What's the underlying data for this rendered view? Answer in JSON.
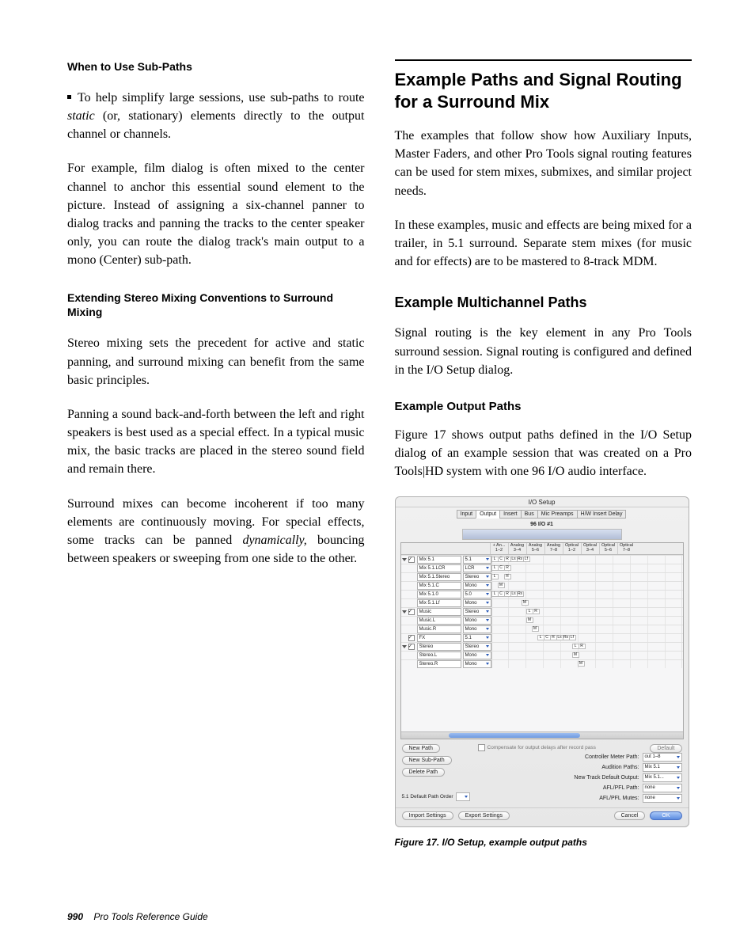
{
  "left": {
    "h1": "When to Use Sub-Paths",
    "bullet_pre": "To help simplify large sessions, use sub-paths to route ",
    "bullet_em": "static",
    "bullet_post": " (or, stationary) elements directly to the output channel or channels.",
    "p2": "For example, film dialog is often mixed to the center channel to anchor this essential sound element to the picture. Instead of assigning a six-channel panner to dialog tracks and panning the tracks to the center speaker only, you can route the dialog track's main output to a mono (Center) sub-path.",
    "h2": "Extending Stereo Mixing Conventions to Surround Mixing",
    "p3": "Stereo mixing sets the precedent for active and static panning, and surround mixing can benefit from the same basic principles.",
    "p4": "Panning a sound back-and-forth between the left and right speakers is best used as a special effect. In a typical music mix, the basic tracks are placed in the stereo sound field and remain there.",
    "p5a": "Surround mixes can become incoherent if too many elements are continuously moving. For special effects, some tracks can be panned ",
    "p5em": "dynamically,",
    "p5b": " bouncing between speakers or sweeping from one side to the other."
  },
  "right": {
    "h1": "Example Paths and Signal Routing for a Surround Mix",
    "p1": "The examples that follow show how Auxiliary Inputs, Master Faders, and other Pro Tools signal routing features can be used for stem mixes, submixes, and similar project needs.",
    "p2": "In these examples, music and effects are being mixed for a trailer, in 5.1 surround. Separate stem mixes (for music and for effects) are to be mastered to 8-track MDM.",
    "h2": "Example Multichannel Paths",
    "p3": "Signal routing is the key element in any Pro Tools surround session. Signal routing is configured and defined in the I/O Setup dialog.",
    "h3": "Example Output Paths",
    "p4": "Figure 17 shows output paths defined in the I/O Setup dialog of an example session that was created on a Pro Tools|HD system with one 96 I/O audio interface."
  },
  "dialog": {
    "title": "I/O Setup",
    "tabs": [
      "Input",
      "Output",
      "Insert",
      "Bus",
      "Mic Preamps",
      "H/W Insert Delay"
    ],
    "hw": "96 I/O #1",
    "col_heads": [
      "+ An...\n1–2",
      "Analog\n3–4",
      "Analog\n5–6",
      "Analog\n7–8",
      "Optical\n1–2",
      "Optical\n3–4",
      "Optical\n5–6",
      "Optical\n7–8"
    ],
    "rows": [
      {
        "tw": true,
        "name": "Mix 5.1",
        "fmt": "5.1",
        "cells": [
          "L",
          "C",
          "R",
          "Ls",
          "Rs",
          "Lf"
        ],
        "offset": 0,
        "checked": true
      },
      {
        "tw": false,
        "name": "Mix 5.1.LCR",
        "fmt": "LCR",
        "cells": [
          "L",
          "C",
          "R"
        ],
        "offset": 0
      },
      {
        "tw": false,
        "name": "Mix 5.1.Stereo",
        "fmt": "Stereo",
        "cells": [
          "L",
          "",
          "R"
        ],
        "offset": 0
      },
      {
        "tw": false,
        "name": "Mix 5.1.C",
        "fmt": "Mono",
        "cells": [
          "",
          "M"
        ],
        "offset": 0
      },
      {
        "tw": false,
        "name": "Mix 5.1.0",
        "fmt": "5.0",
        "cells": [
          "L",
          "C",
          "R",
          "Ls",
          "Rs"
        ],
        "offset": 0
      },
      {
        "tw": false,
        "name": "Mix 5.1.Lf",
        "fmt": "Mono",
        "cells": [
          "M"
        ],
        "offset": 38
      },
      {
        "tw": true,
        "name": "Music",
        "fmt": "Stereo",
        "cells": [
          "L",
          "R"
        ],
        "offset": 44,
        "checked": true
      },
      {
        "tw": false,
        "name": "Music.L",
        "fmt": "Mono",
        "cells": [
          "M"
        ],
        "offset": 44
      },
      {
        "tw": false,
        "name": "Music.R",
        "fmt": "Mono",
        "cells": [
          "M"
        ],
        "offset": 51
      },
      {
        "tw": false,
        "name": "FX",
        "fmt": "5.1",
        "cells": [
          "L",
          "C",
          "R",
          "Ls",
          "Rs",
          "Lf"
        ],
        "offset": 58,
        "checked": true
      },
      {
        "tw": true,
        "name": "Stereo",
        "fmt": "Stereo",
        "cells": [
          "L",
          "R"
        ],
        "offset": 102,
        "checked": true
      },
      {
        "tw": false,
        "name": "Stereo.L",
        "fmt": "Mono",
        "cells": [
          "M"
        ],
        "offset": 102
      },
      {
        "tw": false,
        "name": "Stereo.R",
        "fmt": "Mono",
        "cells": [
          "M"
        ],
        "offset": 109
      }
    ],
    "left_buttons": [
      "New Path",
      "New Sub-Path",
      "Delete Path"
    ],
    "order_label": "5.1 Default Path Order",
    "comp_label": "Compensate for output delays after record pass",
    "default_btn": "Default",
    "opts": [
      {
        "label": "Controller Meter Path:",
        "val": "out 1–8"
      },
      {
        "label": "Audition Paths:",
        "val": "Mix 5.1"
      },
      {
        "label": "New Track Default Output:",
        "val": "Mix 5.1..."
      },
      {
        "label": "AFL/PFL Path:",
        "val": "none"
      },
      {
        "label": "AFL/PFL Mutes:",
        "val": "none"
      }
    ],
    "import": "Import Settings",
    "export": "Export Settings",
    "cancel": "Cancel",
    "ok": "OK"
  },
  "caption": "Figure 17.  I/O Setup, example output paths",
  "footer": {
    "page": "990",
    "guide": "Pro Tools Reference Guide"
  }
}
